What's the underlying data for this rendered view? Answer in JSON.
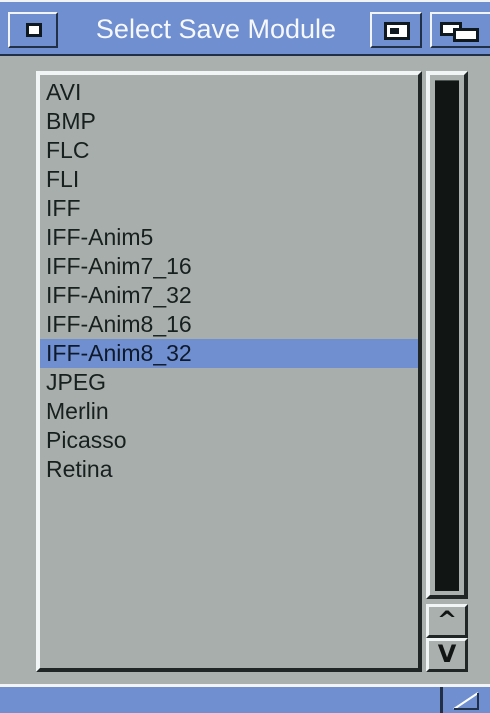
{
  "window": {
    "title": "Select Save Module"
  },
  "titlebar": {
    "icons": [
      "close-icon",
      "zoom-icon",
      "depth-icon"
    ]
  },
  "list": {
    "selected_index": 9,
    "items": [
      {
        "label": "AVI"
      },
      {
        "label": "BMP"
      },
      {
        "label": "FLC"
      },
      {
        "label": "FLI"
      },
      {
        "label": "IFF"
      },
      {
        "label": "IFF-Anim5"
      },
      {
        "label": "IFF-Anim7_16"
      },
      {
        "label": "IFF-Anim7_32"
      },
      {
        "label": "IFF-Anim8_16"
      },
      {
        "label": "IFF-Anim8_32"
      },
      {
        "label": "JPEG"
      },
      {
        "label": "Merlin"
      },
      {
        "label": "Picasso"
      },
      {
        "label": "Retina"
      }
    ]
  },
  "scrollbar": {
    "up_label": "^",
    "down_label": "V",
    "up_icon": "arrow-up-icon",
    "down_icon": "arrow-down-icon"
  },
  "statusbar": {
    "icon": "resize-icon"
  },
  "colors": {
    "window_blue": "#6f8fd0",
    "panel_gray": "#aab0ae",
    "text_dark": "#18201f",
    "scroll_thumb": "#111514"
  }
}
